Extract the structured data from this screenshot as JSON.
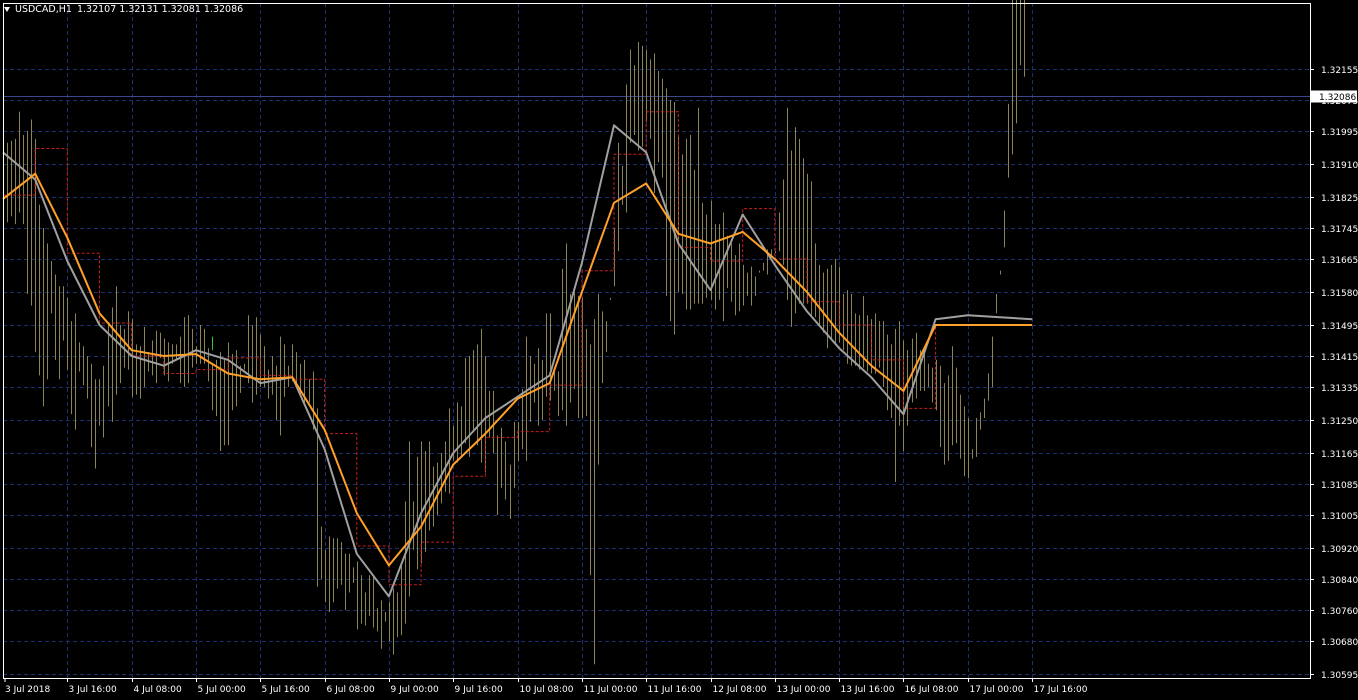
{
  "header": {
    "symbol": "USDCAD,H1",
    "ohlc": "1.32107 1.32131 1.32081 1.32086"
  },
  "colors": {
    "background": "#000000",
    "frame": "#ffffff",
    "grid": "#1c2f6e",
    "candles": "#8c8454",
    "up_tick": "#35c435",
    "ma_fast": "#a0a0a0",
    "ma_slow": "#ffa028",
    "ma_step": "#c81e1e",
    "price_line": "#3b4690",
    "axis_text": "#ffffff"
  },
  "chart_data": {
    "type": "candlestick",
    "symbol": "USDCAD",
    "timeframe": "H1",
    "ylim": [
      1.30595,
      1.32235
    ],
    "y_ticks": [
      "1.32155",
      "1.32075",
      "1.31995",
      "1.31910",
      "1.31825",
      "1.31745",
      "1.31665",
      "1.31580",
      "1.31495",
      "1.31415",
      "1.31335",
      "1.31250",
      "1.31165",
      "1.31085",
      "1.31005",
      "1.30920",
      "1.30840",
      "1.30760",
      "1.30680",
      "1.30595"
    ],
    "x_ticks": [
      "3 Jul 2018",
      "3 Jul 16:00",
      "4 Jul 08:00",
      "5 Jul 00:00",
      "5 Jul 16:00",
      "6 Jul 08:00",
      "9 Jul 00:00",
      "9 Jul 16:00",
      "10 Jul 08:00",
      "11 Jul 00:00",
      "11 Jul 16:00",
      "12 Jul 08:00",
      "13 Jul 00:00",
      "13 Jul 16:00",
      "16 Jul 08:00",
      "17 Jul 00:00",
      "17 Jul 16:00"
    ],
    "current_price": "1.32086",
    "grid": true,
    "series": [
      {
        "kind": "bars",
        "x": [
          0,
          1,
          2,
          3,
          4,
          5,
          6,
          7,
          8,
          9,
          10,
          11,
          12,
          13,
          14,
          15,
          16,
          17,
          18,
          19,
          20,
          21,
          22,
          23,
          24,
          25,
          26,
          27,
          28,
          29,
          30,
          31,
          32,
          33,
          34,
          35,
          36,
          37,
          38,
          39,
          40,
          41,
          42,
          43,
          44,
          45,
          46,
          47,
          48,
          49,
          50,
          51,
          52,
          53,
          54,
          55,
          56,
          57,
          58,
          59,
          60,
          61,
          62,
          63,
          64,
          65,
          66,
          67,
          68,
          69,
          70,
          71,
          72,
          73,
          74,
          75,
          76,
          77,
          78,
          79,
          80,
          81,
          82,
          83,
          84,
          85,
          86,
          87,
          88,
          89,
          90,
          91,
          92,
          93,
          94,
          95,
          96,
          97,
          98,
          99,
          100,
          101,
          102,
          103,
          104,
          105,
          106,
          107,
          108,
          109,
          110,
          111,
          112,
          113,
          114,
          115,
          116,
          117,
          118,
          119,
          120,
          121,
          122,
          123,
          124,
          125,
          126,
          127,
          128,
          129,
          130,
          131,
          132,
          133,
          134,
          135,
          136,
          137,
          138,
          139,
          140,
          141,
          142,
          143,
          144,
          145,
          146,
          147,
          148,
          149,
          150,
          151,
          152,
          153,
          154,
          155,
          156,
          157,
          158,
          159,
          160,
          161,
          162,
          163,
          164,
          165,
          166,
          167,
          168,
          169,
          170,
          171,
          172,
          173,
          174,
          175,
          176,
          177,
          178,
          179,
          180,
          181,
          182,
          183,
          184,
          185,
          186,
          187,
          188,
          189,
          190,
          191,
          192,
          193,
          194,
          195,
          196,
          197,
          198,
          199,
          200,
          201,
          202,
          203,
          204,
          205,
          206,
          207,
          208,
          209,
          210,
          211,
          212,
          213,
          214,
          215,
          216,
          217,
          218,
          219,
          220,
          221,
          222,
          223,
          224,
          225,
          226,
          227,
          228,
          229,
          230,
          231,
          232,
          233,
          234,
          235,
          236,
          237,
          238,
          239,
          240,
          241,
          242,
          243,
          244,
          245,
          246,
          247,
          248,
          249,
          250,
          251,
          252,
          253,
          254,
          255,
          256,
          257,
          258,
          259
        ],
        "high": [
          1.31945,
          1.31965,
          1.3197,
          1.31975,
          1.32045,
          1.31985,
          1.31995,
          1.32025,
          1.31975,
          1.31805,
          1.31745,
          1.31705,
          1.3166,
          1.31625,
          1.31595,
          1.31595,
          1.31565,
          1.31505,
          1.31525,
          1.3145,
          1.3144,
          1.31415,
          1.31395,
          1.31355,
          1.31355,
          1.3139,
          1.31495,
          1.3154,
          1.31595,
          1.31495,
          1.31485,
          1.3153,
          1.3151,
          1.31445,
          1.3144,
          1.3149,
          1.31425,
          1.31455,
          1.3148,
          1.31475,
          1.3146,
          1.3145,
          1.31445,
          1.31445,
          1.31465,
          1.31515,
          1.3152,
          1.31485,
          1.3144,
          1.31495,
          1.31485,
          1.31435,
          1.31395,
          1.31405,
          1.31425,
          1.31405,
          1.3145,
          1.3142,
          1.3143,
          1.3139,
          1.31395,
          1.3152,
          1.31495,
          1.31515,
          1.3147,
          1.3144,
          1.3138,
          1.31415,
          1.3139,
          1.31465,
          1.31445,
          1.3139,
          1.31445,
          1.31425,
          1.31395,
          1.31405,
          1.31355,
          1.31375,
          1.3128,
          1.30975,
          1.30915,
          1.3095,
          1.30945,
          1.30945,
          1.30935,
          1.30905,
          1.30905,
          1.3087,
          1.30885,
          1.3085,
          1.30805,
          1.3085,
          1.30845,
          1.30765,
          1.30785,
          1.30755,
          1.3078,
          1.30815,
          1.30805,
          1.30875,
          1.3104,
          1.31195,
          1.3104,
          1.31155,
          1.31195,
          1.3117,
          1.31195,
          1.3113,
          1.3114,
          1.31165,
          1.31195,
          1.3128,
          1.31235,
          1.31295,
          1.31285,
          1.3141,
          1.31415,
          1.3143,
          1.31445,
          1.31485,
          1.31415,
          1.31325,
          1.31325,
          1.3121,
          1.3123,
          1.31195,
          1.31135,
          1.31245,
          1.31245,
          1.3133,
          1.31465,
          1.31415,
          1.31395,
          1.31435,
          1.31405,
          1.31525,
          1.31525,
          1.31385,
          1.31375,
          1.3164,
          1.31705,
          1.31575,
          1.3158,
          1.3157,
          1.31565,
          1.31485,
          1.31445,
          1.3151,
          1.31575,
          1.3153,
          1.31505,
          1.3156,
          1.31745,
          1.31965,
          1.31905,
          1.32115,
          1.32205,
          1.32165,
          1.32225,
          1.32215,
          1.32205,
          1.3218,
          1.32195,
          1.3215,
          1.3213,
          1.32105,
          1.32075,
          1.3207,
          1.3198,
          1.31935,
          1.31975,
          1.31985,
          1.31895,
          1.32055,
          1.3181,
          1.3178,
          1.31815,
          1.31755,
          1.31755,
          1.31785,
          1.31725,
          1.31705,
          1.31675,
          1.31705,
          1.3165,
          1.3163,
          1.31645,
          1.3162,
          1.3163,
          1.31655,
          1.3169,
          1.3169,
          1.31685,
          1.31785,
          1.3187,
          1.32055,
          1.31945,
          1.32005,
          1.31975,
          1.31925,
          1.31885,
          1.31865,
          1.31705,
          1.3165,
          1.3163,
          1.3164,
          1.3165,
          1.31665,
          1.31645,
          1.31575,
          1.31585,
          1.31575,
          1.31525,
          1.3152,
          1.3157,
          1.3152,
          1.3151,
          1.31525,
          1.31505,
          1.31505,
          1.3147,
          1.31445,
          1.31485,
          1.31505,
          1.31455,
          1.3143,
          1.3146,
          1.31475,
          1.3143,
          1.3143,
          1.31395,
          1.31385,
          1.31405,
          1.3139,
          1.31345,
          1.31365,
          1.3144,
          1.31385,
          1.31315,
          1.31285,
          1.31255,
          1.31175,
          1.31255,
          1.3127,
          1.31255,
          1.313,
          1.31335,
          1.31525,
          1.31625,
          1.31695,
          1.31875,
          1.31935,
          1.32015,
          1.32165,
          1.32135
        ],
        "low": [
          1.31755,
          1.3176,
          1.31775,
          1.31755,
          1.31785,
          1.31755,
          1.31575,
          1.31545,
          1.31425,
          1.31365,
          1.31285,
          1.31355,
          1.31525,
          1.31405,
          1.31355,
          1.31455,
          1.3138,
          1.31265,
          1.31225,
          1.31375,
          1.3134,
          1.31305,
          1.3118,
          1.31125,
          1.31235,
          1.31205,
          1.31285,
          1.31245,
          1.31315,
          1.31345,
          1.31385,
          1.3138,
          1.3131,
          1.31315,
          1.31305,
          1.31335,
          1.31375,
          1.31365,
          1.31345,
          1.3141,
          1.31365,
          1.3135,
          1.31395,
          1.31405,
          1.31345,
          1.31335,
          1.31345,
          1.31385,
          1.31395,
          1.31395,
          1.31395,
          1.3135,
          1.31275,
          1.3126,
          1.3117,
          1.31185,
          1.31185,
          1.31275,
          1.31285,
          1.3132,
          1.3138,
          1.31345,
          1.31295,
          1.31315,
          1.31335,
          1.31335,
          1.31305,
          1.31315,
          1.3125,
          1.3121,
          1.3131,
          1.31335,
          1.3135,
          1.31335,
          1.31315,
          1.31295,
          1.31295,
          1.31225,
          1.3082,
          1.3084,
          1.3078,
          1.30755,
          1.3078,
          1.30815,
          1.30825,
          1.3076,
          1.30805,
          1.3083,
          1.3071,
          1.30725,
          1.3072,
          1.30745,
          1.30715,
          1.30705,
          1.3066,
          1.3073,
          1.3068,
          1.30645,
          1.3069,
          1.30695,
          1.30725,
          1.30795,
          1.30915,
          1.30865,
          1.3088,
          1.3091,
          1.30965,
          1.30975,
          1.31005,
          1.31035,
          1.31065,
          1.3106,
          1.31145,
          1.3114,
          1.31155,
          1.3119,
          1.31155,
          1.31225,
          1.31185,
          1.3114,
          1.31115,
          1.31205,
          1.31165,
          1.31005,
          1.31075,
          1.31045,
          1.30995,
          1.31075,
          1.31145,
          1.31175,
          1.31145,
          1.31245,
          1.31295,
          1.31235,
          1.3125,
          1.3131,
          1.313,
          1.31325,
          1.3126,
          1.31275,
          1.31235,
          1.31295,
          1.3133,
          1.31255,
          1.31255,
          1.3126,
          1.3085,
          1.3062,
          1.31135,
          1.31345,
          1.31425,
          1.31565,
          1.31595,
          1.31685,
          1.31805,
          1.31785,
          1.31965,
          1.31985,
          1.31945,
          1.31955,
          1.3202,
          1.31975,
          1.31835,
          1.31915,
          1.31875,
          1.3157,
          1.31505,
          1.3147,
          1.3158,
          1.31575,
          1.31535,
          1.31535,
          1.3155,
          1.3155,
          1.3155,
          1.31565,
          1.3156,
          1.31535,
          1.3156,
          1.31505,
          1.3159,
          1.31555,
          1.3152,
          1.3153,
          1.31545,
          1.3157,
          1.31545,
          1.3157,
          1.31635,
          1.31635,
          1.31625,
          1.3167,
          1.3168,
          1.31685,
          1.3165,
          1.3156,
          1.3149,
          1.31525,
          1.3155,
          1.3155,
          1.3155,
          1.3152,
          1.31515,
          1.3149,
          1.31475,
          1.31435,
          1.3146,
          1.31445,
          1.3145,
          1.3143,
          1.31395,
          1.3139,
          1.3139,
          1.3138,
          1.31385,
          1.31375,
          1.3137,
          1.3137,
          1.31385,
          1.31335,
          1.31275,
          1.31255,
          1.3109,
          1.31235,
          1.3117,
          1.31235,
          1.31295,
          1.31305,
          1.31325,
          1.31325,
          1.31335,
          1.31295,
          1.31275,
          1.3118,
          1.31135,
          1.31145,
          1.31185,
          1.3119,
          1.3115,
          1.31105,
          1.311,
          1.3115,
          1.31155,
          1.31225,
          1.31305,
          1.3137,
          1.31465,
          1.31575,
          1.31635,
          1.3179,
          1.32065
        ]
      },
      {
        "name": "",
        "kind": "line",
        "color": "#a0a0a0",
        "x": [
          0,
          8,
          16,
          24,
          32,
          40,
          48,
          56,
          64,
          72,
          80,
          88,
          96,
          104,
          112,
          120,
          128,
          136,
          144,
          152,
          160,
          168,
          176,
          184,
          192,
          200,
          208,
          216,
          224,
          232,
          240,
          248,
          256
        ],
        "y": [
          1.3194,
          1.3187,
          1.3166,
          1.31495,
          1.31415,
          1.3139,
          1.3143,
          1.31405,
          1.31345,
          1.3136,
          1.31175,
          1.30905,
          1.30795,
          1.3101,
          1.31165,
          1.31255,
          1.3131,
          1.31365,
          1.31655,
          1.3201,
          1.3194,
          1.31705,
          1.31585,
          1.3178,
          1.3165,
          1.3153,
          1.31435,
          1.3136,
          1.31265,
          1.3151,
          1.3152,
          1.31515,
          1.3151
        ]
      },
      {
        "name": "",
        "kind": "line",
        "color": "#ffa028",
        "x": [
          0,
          8,
          16,
          24,
          32,
          40,
          48,
          56,
          64,
          72,
          80,
          88,
          96,
          104,
          112,
          120,
          128,
          136,
          144,
          152,
          160,
          168,
          176,
          184,
          192,
          200,
          208,
          216,
          224,
          232,
          240,
          248,
          256
        ],
        "y": [
          1.3182,
          1.31885,
          1.3172,
          1.31525,
          1.3143,
          1.31415,
          1.3142,
          1.3137,
          1.31355,
          1.3136,
          1.31225,
          1.3101,
          1.30875,
          1.30975,
          1.31135,
          1.31215,
          1.31305,
          1.31345,
          1.3158,
          1.3181,
          1.3186,
          1.3173,
          1.31705,
          1.31735,
          1.31665,
          1.3158,
          1.31475,
          1.3139,
          1.31325,
          1.31495,
          1.31495,
          1.31495,
          1.31495
        ]
      },
      {
        "name": "",
        "kind": "step",
        "color": "#c81e1e",
        "x": [
          0,
          8,
          16,
          24,
          32,
          40,
          48,
          56,
          64,
          72,
          80,
          88,
          96,
          104,
          112,
          120,
          128,
          136,
          144,
          152,
          160,
          168,
          176,
          184,
          192,
          200,
          208,
          216,
          224,
          232,
          240,
          248,
          256
        ],
        "y": [
          1.3183,
          1.3195,
          1.3168,
          1.315,
          1.31415,
          1.3137,
          1.3138,
          1.3141,
          1.31365,
          1.31355,
          1.31215,
          1.30925,
          1.30825,
          1.30935,
          1.31105,
          1.31205,
          1.3122,
          1.3134,
          1.31635,
          1.31935,
          1.32045,
          1.31695,
          1.3166,
          1.31795,
          1.31665,
          1.31555,
          1.31495,
          1.31405,
          1.3128,
          1.31495,
          1.31495,
          1.31495,
          1.31495
        ]
      }
    ]
  }
}
